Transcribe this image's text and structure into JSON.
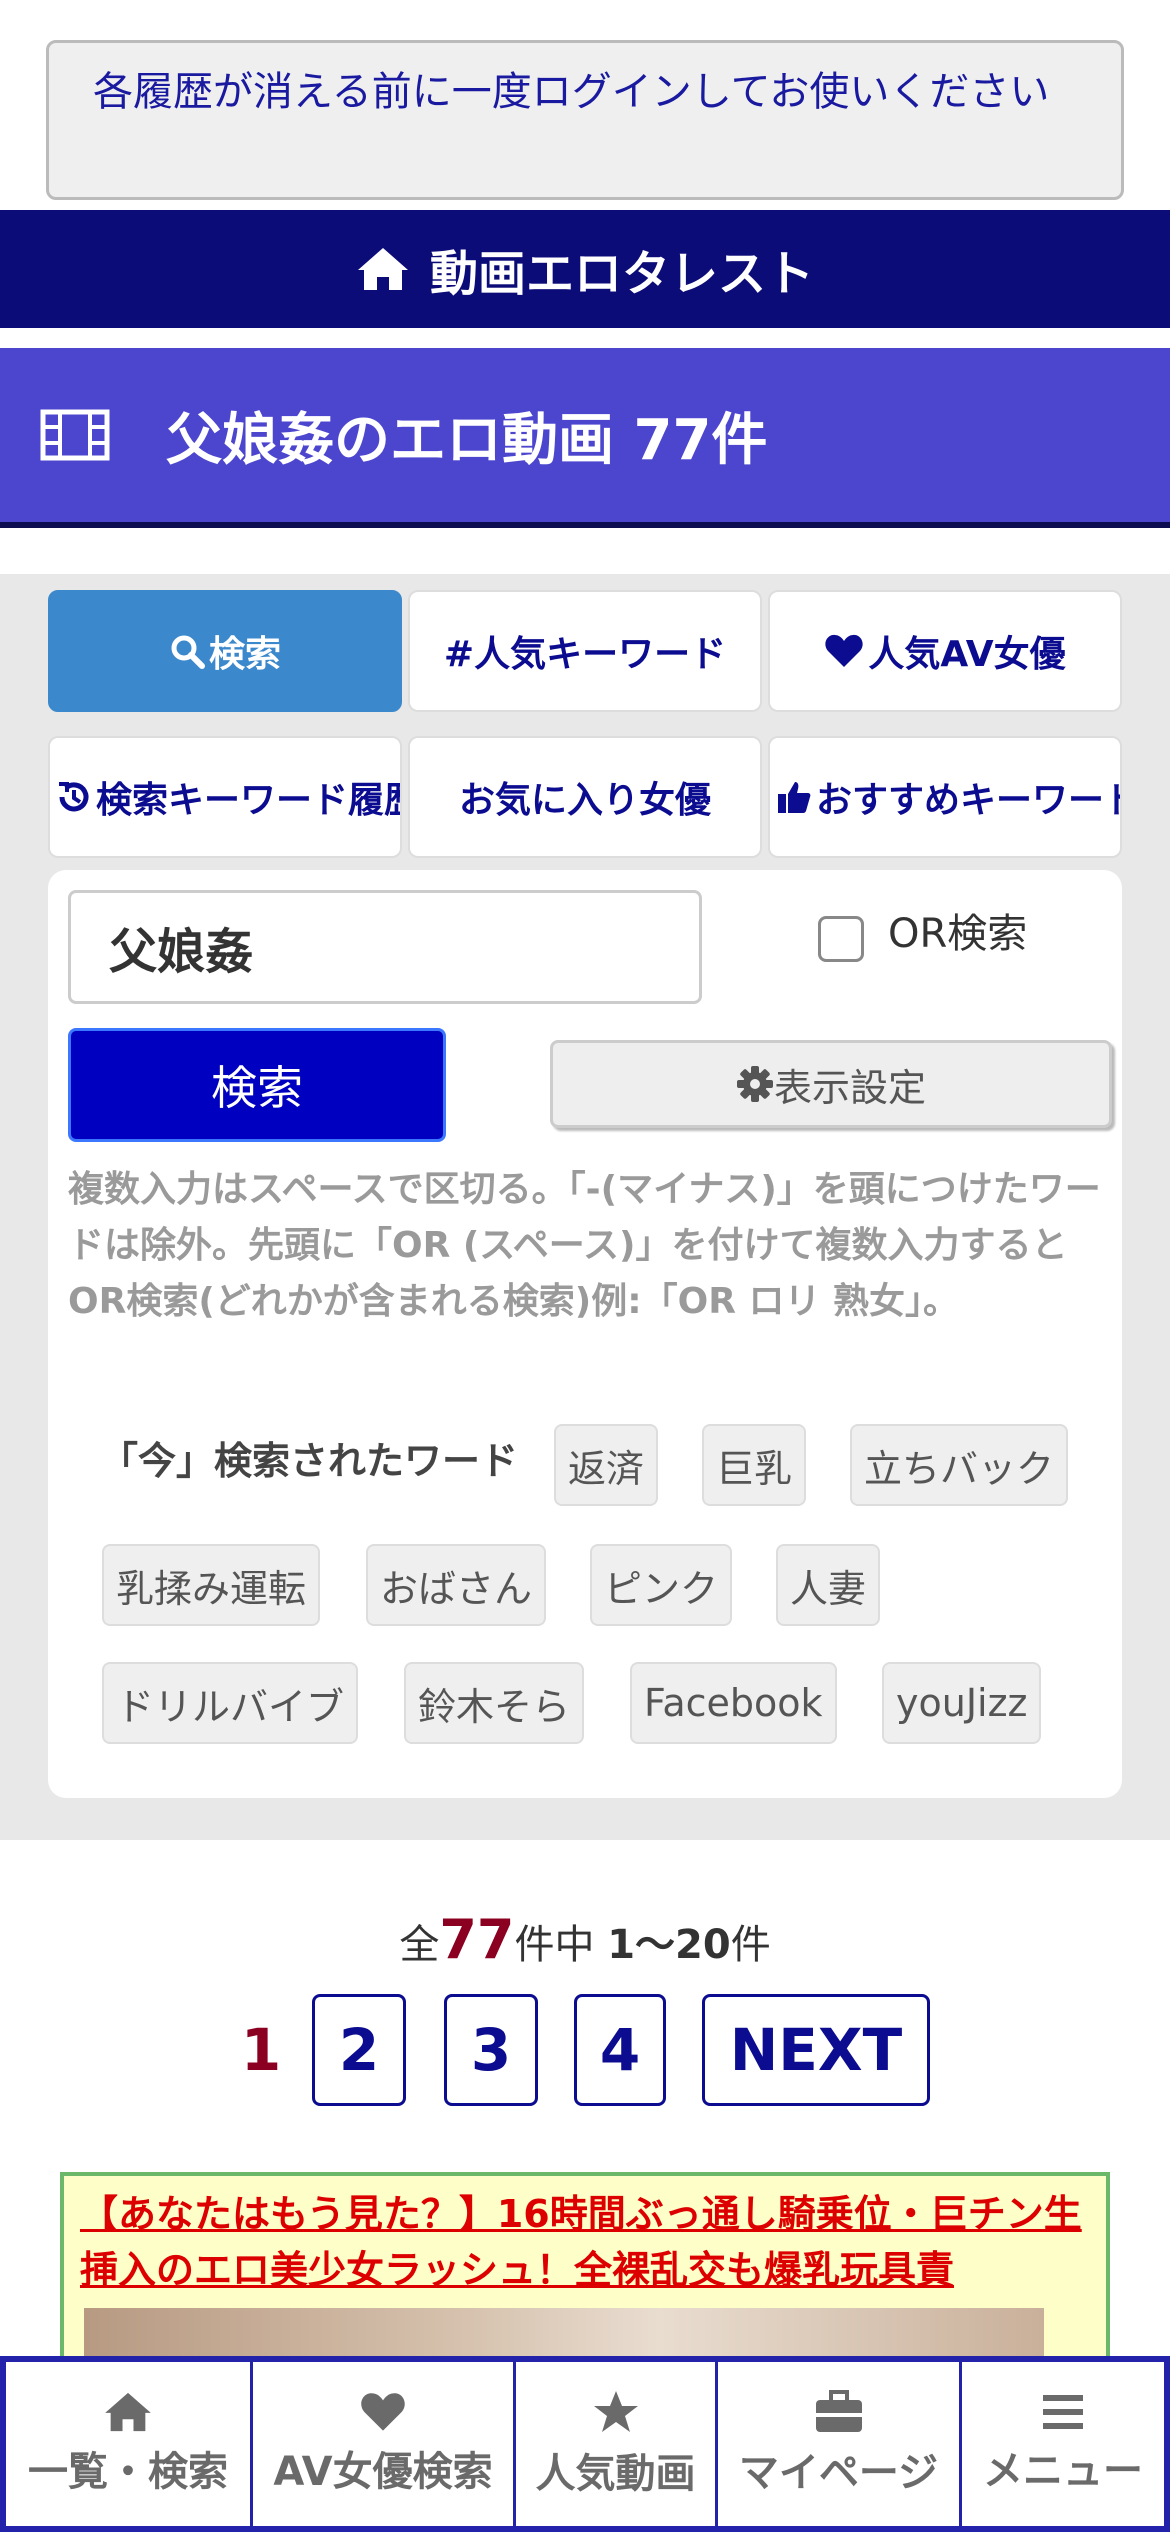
{
  "notice": {
    "text": "各履歴が消える前に一度ログインしてお使いください"
  },
  "header": {
    "site_title": "動画エロタレスト"
  },
  "title_bar": {
    "title": "父娘姦のエロ動画 77件"
  },
  "tabs": [
    {
      "label": "検索",
      "icon": "search-icon",
      "active": true
    },
    {
      "label": "#人気キーワード",
      "icon": "",
      "active": false
    },
    {
      "label": "人気AV女優",
      "icon": "heart-icon",
      "active": false
    },
    {
      "label": "検索キーワード履歴",
      "icon": "history-icon",
      "active": false
    },
    {
      "label": "お気に入り女優",
      "icon": "",
      "active": false
    },
    {
      "label": "おすすめキーワード",
      "icon": "thumbs-up-icon",
      "active": false
    }
  ],
  "search": {
    "query": "父娘姦",
    "or_label": "OR検索",
    "or_checked": false,
    "button_label": "検索",
    "settings_label": "表示設定",
    "help_text": "複数入力はスペースで区切る。「-(マイナス)」を頭につけたワードは除外。先頭に「OR (スペース)」を付けて複数入力するとOR検索(どれかが含まれる検索)例:「OR ロリ 熟女」。",
    "now_label": "「今」検索されたワード",
    "now_words": [
      "返済",
      "巨乳",
      "立ちバック",
      "乳揉み運転",
      "おばさん",
      "ピンク",
      "人妻",
      "ドリルバイブ",
      "鈴木そら",
      "Facebook",
      "youJizz"
    ]
  },
  "results": {
    "prefix": "全",
    "total": "77",
    "middle": "件中 ",
    "range": "1〜20",
    "suffix": "件"
  },
  "pagination": {
    "current": "1",
    "pages": [
      "2",
      "3",
      "4"
    ],
    "next": "NEXT"
  },
  "ad": {
    "title": "【あなたはもう見た？】16時間ぶっ通し騎乗位・巨チン生挿入のエロ美少女ラッシュ！全裸乱交も爆乳玩具責"
  },
  "bottom_nav": [
    {
      "label": "一覧・検索",
      "icon": "home-icon"
    },
    {
      "label": "AV女優検索",
      "icon": "heart-icon"
    },
    {
      "label": "人気動画",
      "icon": "star-icon"
    },
    {
      "label": "マイページ",
      "icon": "briefcase-icon"
    },
    {
      "label": "メニュー",
      "icon": "menu-icon"
    }
  ],
  "colors": {
    "header_bg": "#0c0c78",
    "title_bg": "#4c46cf",
    "active_tab": "#3b88cc",
    "search_button": "#0000c0",
    "accent_red": "#8b0020"
  }
}
